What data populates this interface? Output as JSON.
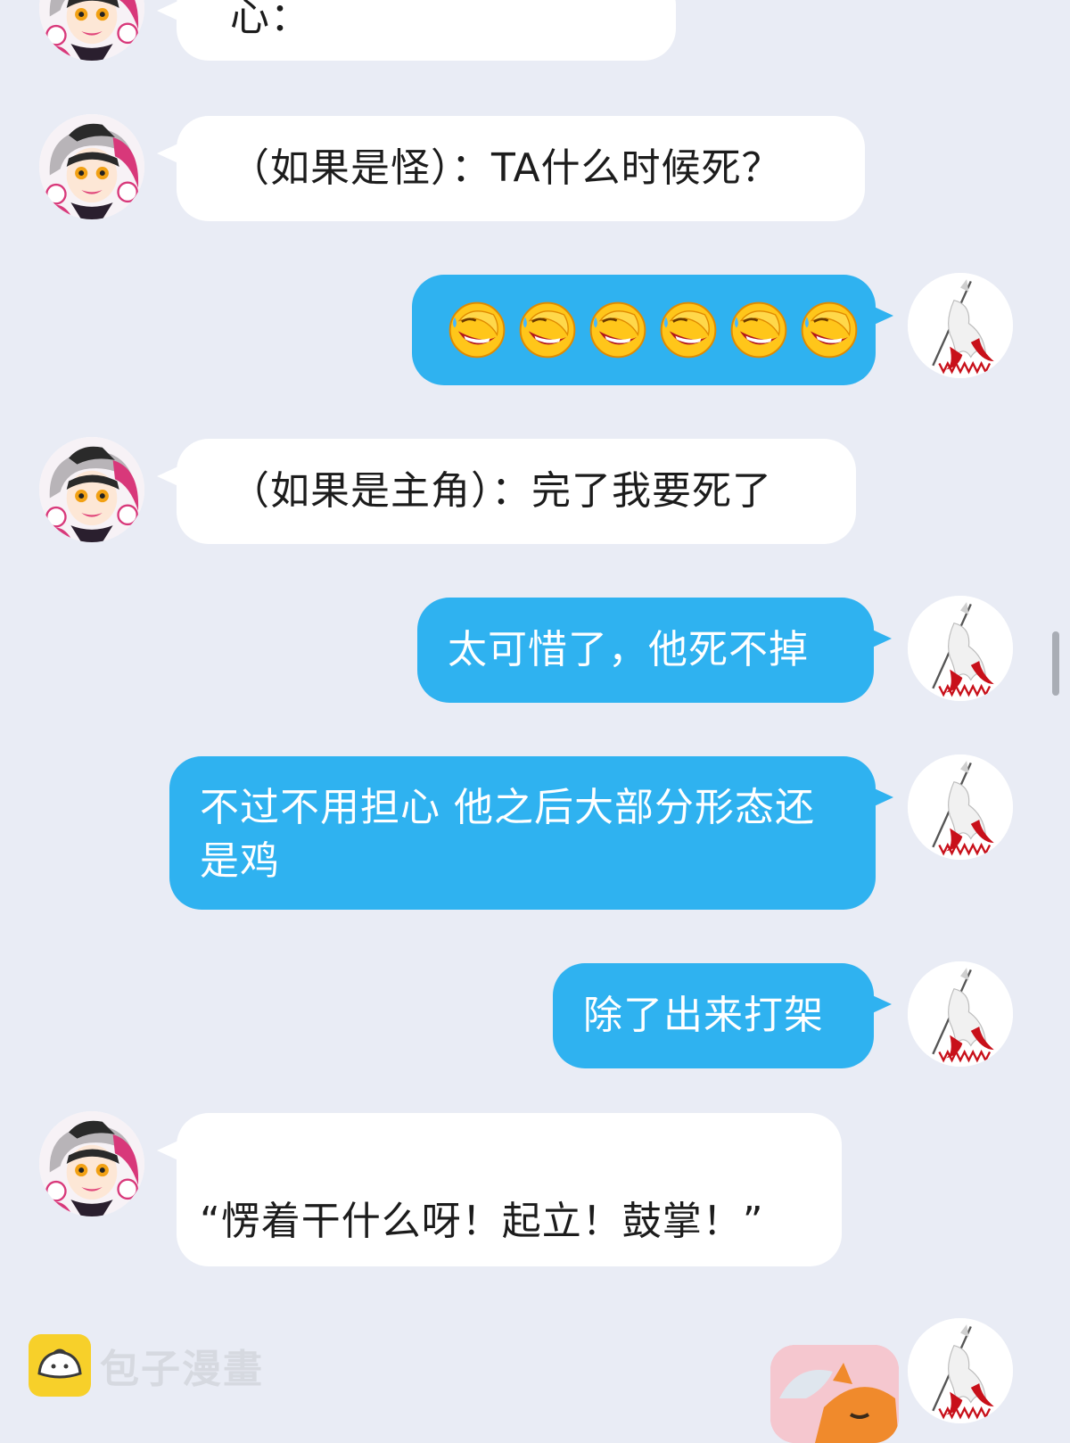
{
  "messages": [
    {
      "side": "in",
      "text": "这个时候上色的内心："
    },
    {
      "side": "in",
      "text": "（如果是怪）：TA什么时候死？"
    },
    {
      "side": "out",
      "emoji_name": "laugh-cry-emoji",
      "emoji_count": 6
    },
    {
      "side": "in",
      "text": "（如果是主角）：完了我要死了"
    },
    {
      "side": "out",
      "text": "太可惜了，他死不掉"
    },
    {
      "side": "out",
      "text": "不过不用担心 他之后大部分形态还是鸡"
    },
    {
      "side": "out",
      "text": "除了出来打架"
    },
    {
      "side": "in",
      "text": "“愣着干什么呀！起立！鼓掌！”"
    },
    {
      "side": "out",
      "sticker": "fox-sticker"
    }
  ],
  "watermark": {
    "text": "包子漫畫",
    "icon": "bun-icon"
  },
  "colors": {
    "background": "#e9ecf5",
    "incoming_bubble": "#ffffff",
    "outgoing_bubble": "#2fb2f0",
    "outgoing_text": "#ffffff"
  }
}
